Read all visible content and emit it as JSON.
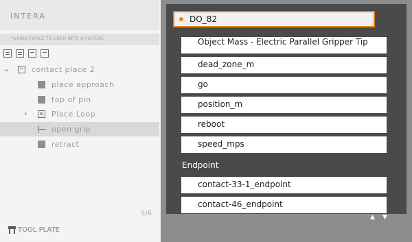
{
  "sidebar": {
    "app_title": "INTERA",
    "subtitle": "*USING FORCE TO LOCK INTO A FIXTURE",
    "tree": {
      "parent": "contact place 2",
      "children": [
        {
          "label": "place approach",
          "icon": "square-icon"
        },
        {
          "label": "top of pin",
          "icon": "square-icon"
        },
        {
          "label": "Place Loop",
          "icon": "loop-icon"
        },
        {
          "label": "open grip",
          "icon": "gripper-icon"
        },
        {
          "label": "retract",
          "icon": "square-icon"
        }
      ]
    },
    "page_indicator": "5/6",
    "footer_label": "TOOL PLATE"
  },
  "dropdown": {
    "selected_value": "DO_82",
    "options_group1": [
      "Object Mass - Electric Parallel Gripper Tip",
      "dead_zone_m",
      "go",
      "position_m",
      "reboot",
      "speed_mps"
    ],
    "group_header": "Endpoint",
    "options_group2": [
      "contact-33-1_endpoint",
      "contact-46_endpoint"
    ]
  },
  "scroll": {
    "up_arrow": "^",
    "down_arrow": "v"
  },
  "colors": {
    "accent": "#e6861a",
    "selected_row": "#d9d9d9",
    "panel_dark": "#4a4a4a"
  }
}
